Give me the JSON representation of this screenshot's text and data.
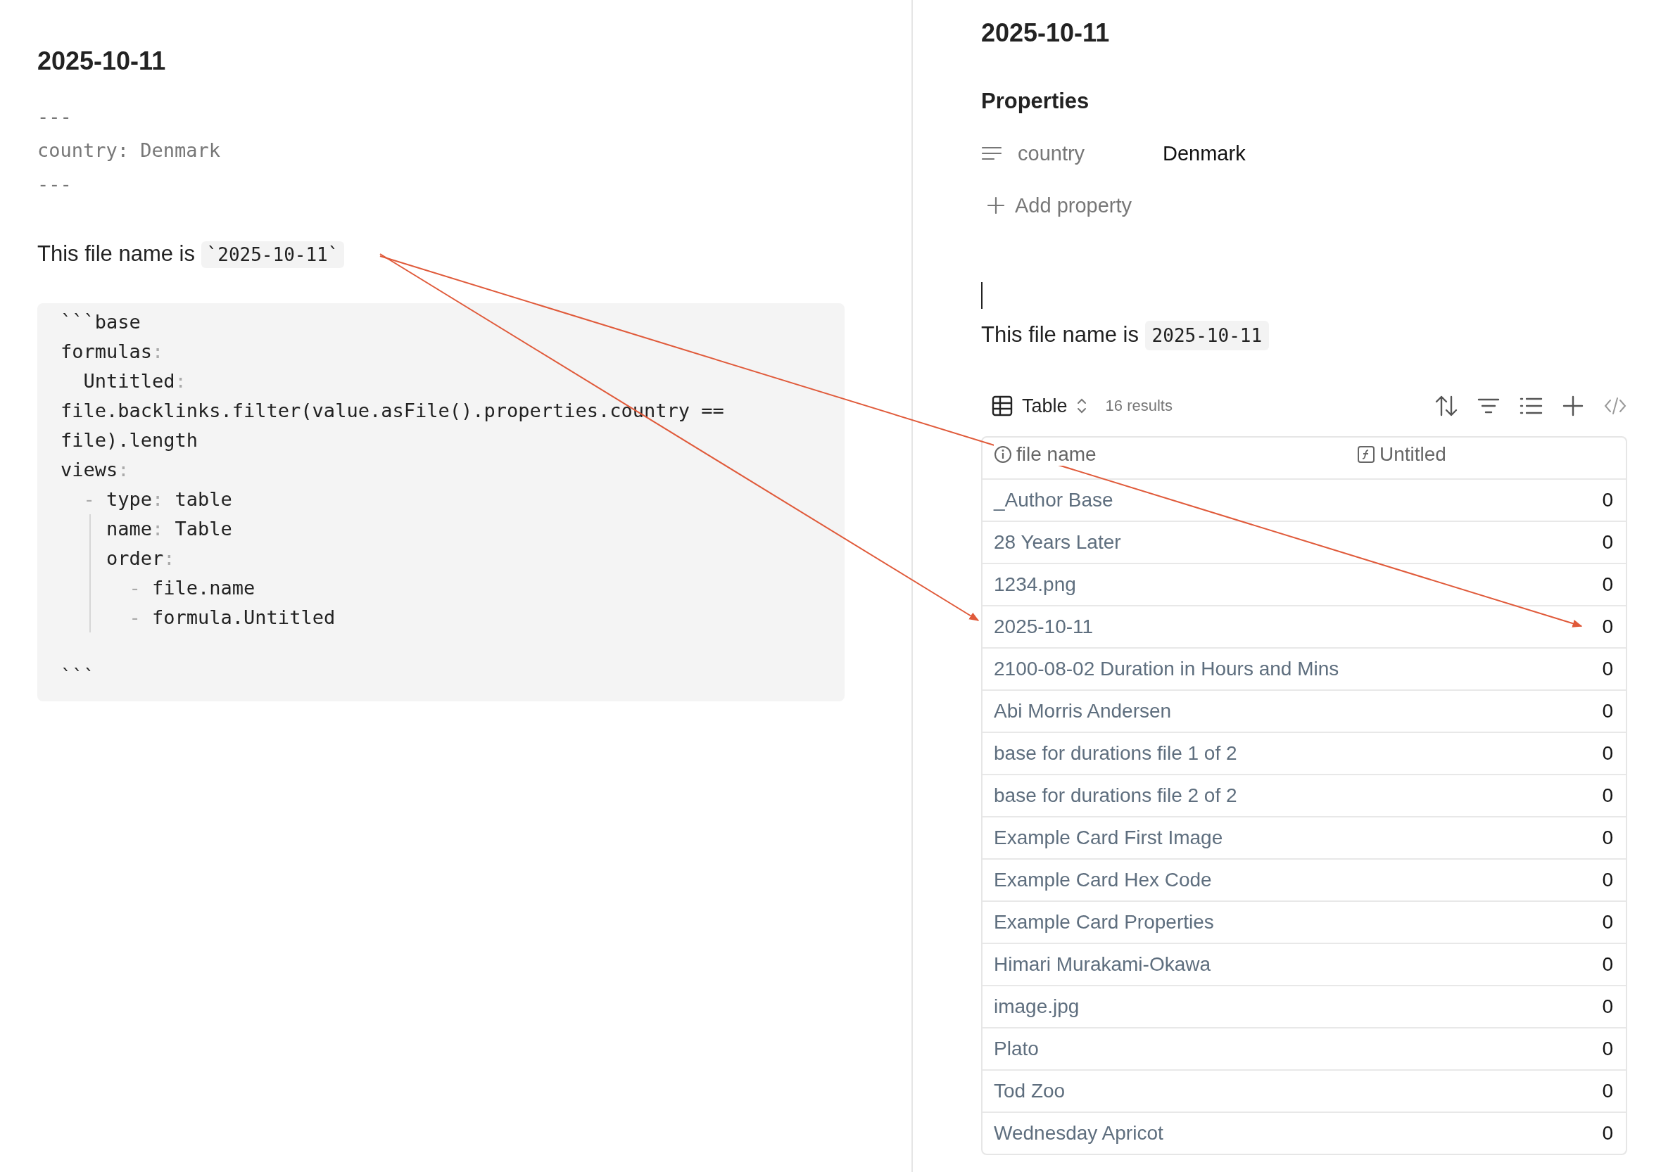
{
  "source_pane": {
    "title": "2025-10-11",
    "frontmatter": [
      "---",
      "country: Denmark",
      "---"
    ],
    "paragraph": {
      "text": "This file name is",
      "code": "`2025-10-11`"
    },
    "code_block": [
      "```base",
      "formulas:",
      "  Untitled:",
      "file.backlinks.filter(value.asFile().properties.country ==",
      "file).length",
      "views:",
      "  - type: table",
      "    name: Table",
      "    order:",
      "      - file.name",
      "      - formula.Untitled"
    ],
    "code_block_end": "```"
  },
  "preview_pane": {
    "title": "2025-10-11",
    "properties": {
      "heading": "Properties",
      "items": [
        {
          "name": "country",
          "value": "Denmark"
        }
      ],
      "add_label": "Add property"
    },
    "paragraph": {
      "text": "This file name is",
      "code": "2025-10-11"
    },
    "base": {
      "view": "Table",
      "results": "16 results",
      "columns": [
        "file name",
        "Untitled"
      ],
      "rows": [
        {
          "name": "_Author Base",
          "value": "0"
        },
        {
          "name": "28 Years Later",
          "value": "0"
        },
        {
          "name": "1234.png",
          "value": "0"
        },
        {
          "name": "2025-10-11",
          "value": "0"
        },
        {
          "name": "2100-08-02 Duration in Hours and Mins",
          "value": "0"
        },
        {
          "name": "Abi Morris Andersen",
          "value": "0"
        },
        {
          "name": "base for durations file 1 of 2",
          "value": "0"
        },
        {
          "name": "base for durations file 2 of 2",
          "value": "0"
        },
        {
          "name": "Example Card First Image",
          "value": "0"
        },
        {
          "name": "Example Card Hex Code",
          "value": "0"
        },
        {
          "name": "Example Card Properties",
          "value": "0"
        },
        {
          "name": "Himari Murakami-Okawa",
          "value": "0"
        },
        {
          "name": "image.jpg",
          "value": "0"
        },
        {
          "name": "Plato",
          "value": "0"
        },
        {
          "name": "Tod Zoo",
          "value": "0"
        },
        {
          "name": "Wednesday Apricot",
          "value": "0"
        }
      ]
    }
  }
}
